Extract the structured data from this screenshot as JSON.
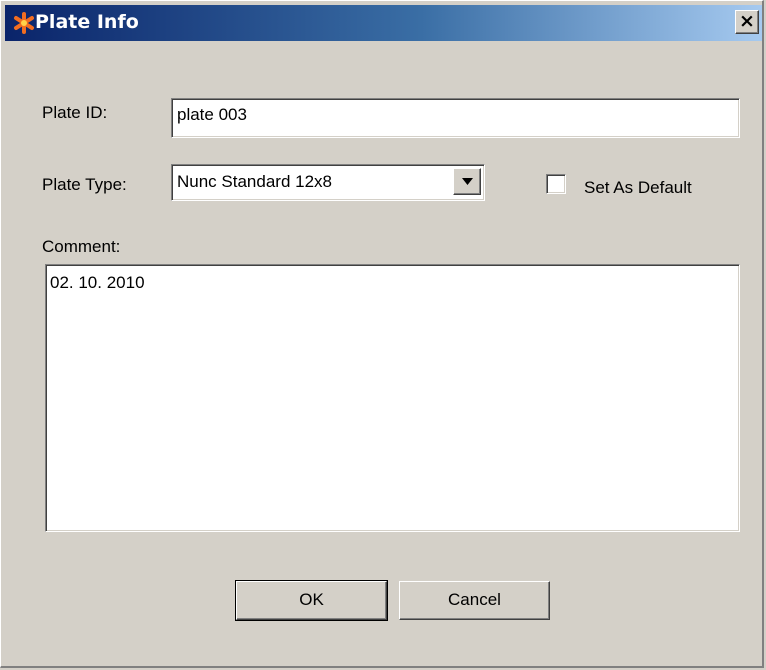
{
  "window": {
    "title": "Plate Info",
    "close_glyph": "×",
    "icon": "asterisk-app-icon"
  },
  "form": {
    "plate_id": {
      "label": "Plate ID:",
      "value": "plate 003"
    },
    "plate_type": {
      "label": "Plate Type:",
      "value": "Nunc Standard 12x8"
    },
    "set_as_default": {
      "label": "Set As Default",
      "checked": false
    },
    "comment": {
      "label": "Comment:",
      "value": "02. 10. 2010"
    }
  },
  "buttons": {
    "ok": "OK",
    "cancel": "Cancel"
  },
  "colors": {
    "title_gradient_start": "#0a246a",
    "title_gradient_end": "#a6caf0",
    "face": "#d4d0c8"
  }
}
